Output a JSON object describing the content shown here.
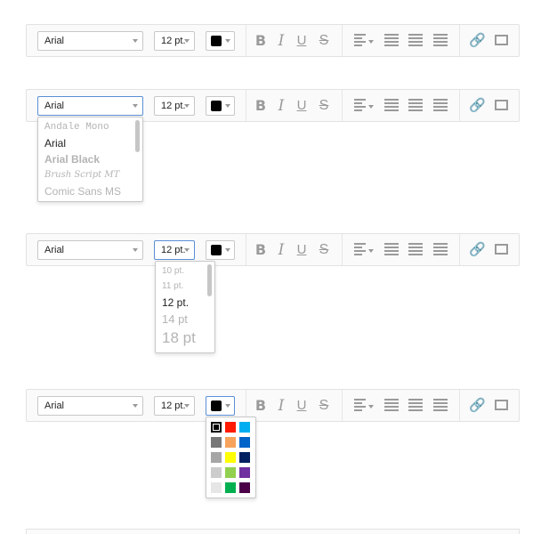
{
  "toolbar": {
    "font_value": "Arial",
    "size_value": "12 pt.",
    "swatch_color": "#000000",
    "bold": "B",
    "italic": "I",
    "underline": "U",
    "strike": "S"
  },
  "font_dropdown": {
    "options": [
      "Andale Mono",
      "Arial",
      "Arial Black",
      "Brush Script MT",
      "Comic Sans MS"
    ],
    "selected": "Arial"
  },
  "size_dropdown": {
    "options": [
      "10 pt.",
      "11 pt.",
      "12 pt.",
      "14 pt",
      "18 pt"
    ],
    "selected": "12 pt."
  },
  "color_palette": {
    "selected": "#000000",
    "colors": [
      [
        "#000000",
        "#ff1a00",
        "#00aeef"
      ],
      [
        "#777777",
        "#f7a35c",
        "#0064c8"
      ],
      [
        "#a6a6a6",
        "#ffff00",
        "#002060"
      ],
      [
        "#cccccc",
        "#92d050",
        "#7030a0"
      ],
      [
        "#e6e6e6",
        "#00b050",
        "#4b0048"
      ]
    ]
  }
}
